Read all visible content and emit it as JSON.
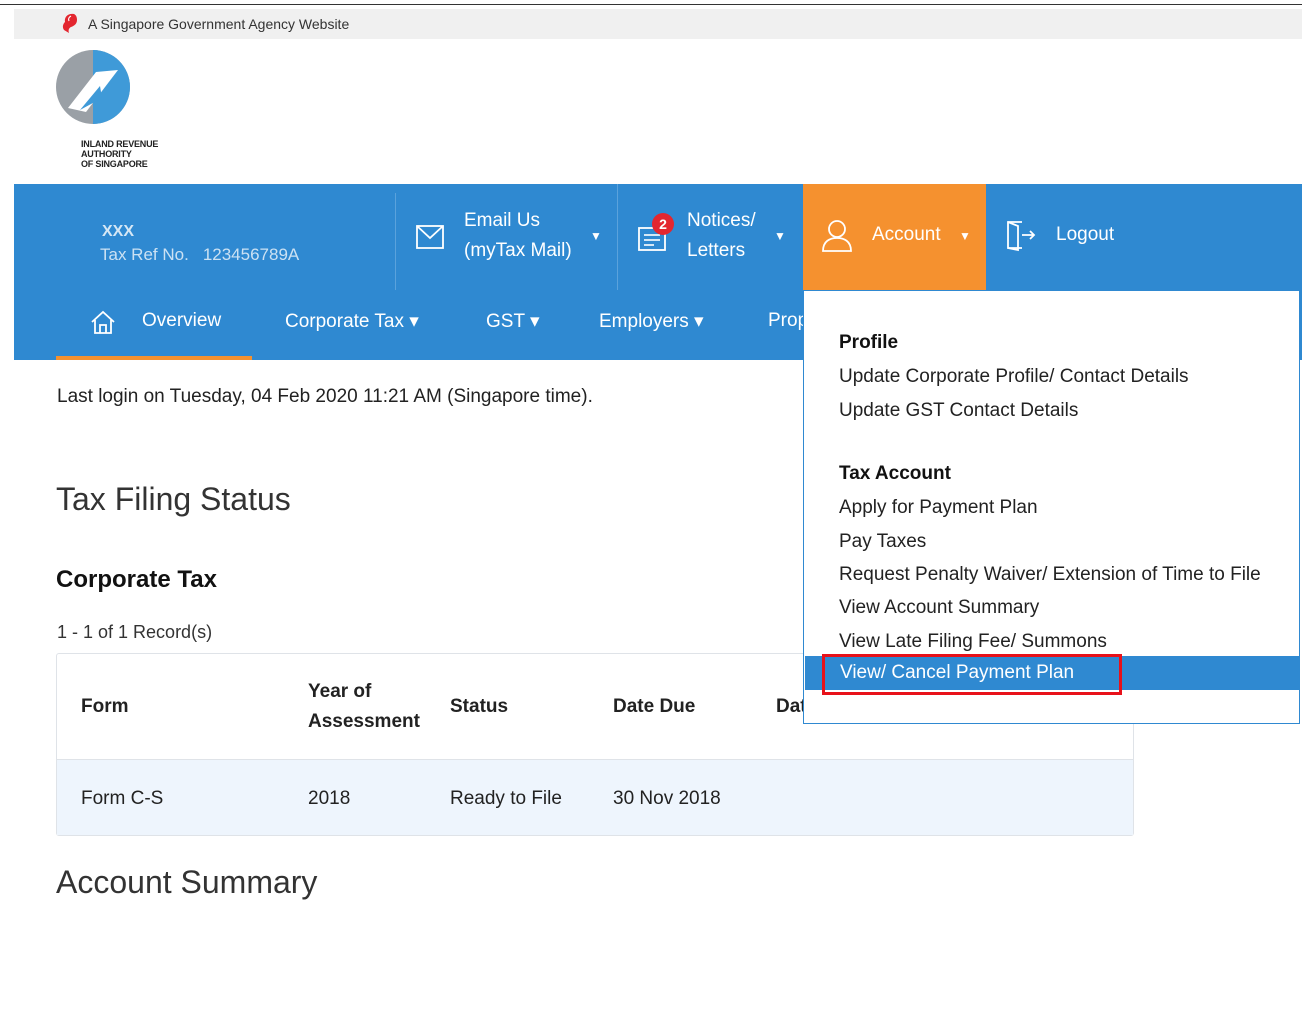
{
  "gov_banner": {
    "text": "A Singapore Government Agency Website"
  },
  "logo": {
    "line1": "INLAND REVENUE",
    "line2": "AUTHORITY",
    "line3": "OF SINGAPORE"
  },
  "user": {
    "name": "XXX",
    "tax_ref_label": "Tax Ref No.",
    "tax_ref_value": "123456789A"
  },
  "top_nav": {
    "email_line1": "Email Us",
    "email_line2": "(myTax Mail)",
    "notices_line1": "Notices/",
    "notices_line2": "Letters",
    "notices_badge": "2",
    "account": "Account",
    "logout": "Logout"
  },
  "main_nav": {
    "overview": "Overview",
    "corporate_tax": "Corporate Tax ▾",
    "gst": "GST ▾",
    "employers": "Employers ▾",
    "property": "Prop"
  },
  "last_login": "Last login on Tuesday, 04 Feb 2020 11:21 AM (Singapore time).",
  "tax_filing": {
    "title": "Tax Filing Status",
    "section": "Corporate Tax",
    "records": "1 - 1 of 1 Record(s)",
    "headers": {
      "form": "Form",
      "year_line1": "Year of",
      "year_line2": "Assessment",
      "status": "Status",
      "date_due": "Date Due",
      "date_filed": "Dat"
    },
    "rows": [
      {
        "form": "Form C-S",
        "year": "2018",
        "status": "Ready to File",
        "date_due": "30 Nov 2018"
      }
    ]
  },
  "account_summary": {
    "title": "Account Summary"
  },
  "account_menu": {
    "profile_heading": "Profile",
    "profile_items": [
      "Update Corporate Profile/ Contact Details",
      "Update GST Contact Details"
    ],
    "tax_heading": "Tax Account",
    "tax_items": [
      "Apply for Payment Plan",
      "Pay Taxes",
      "Request Penalty Waiver/ Extension of Time to File",
      "View Account Summary",
      "View Late Filing Fee/ Summons"
    ],
    "highlighted_item": "View/ Cancel Payment Plan"
  },
  "colors": {
    "nav_blue": "#2f89d1",
    "accent_orange": "#f5912f",
    "highlight_red": "#e8111a"
  }
}
